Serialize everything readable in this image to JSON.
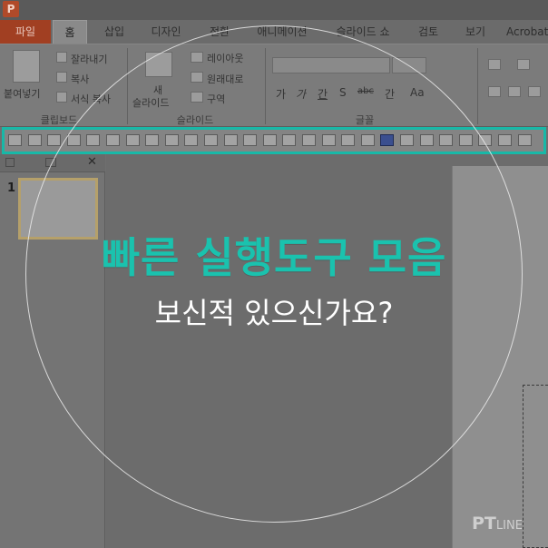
{
  "app": {
    "logo_letter": "P"
  },
  "tabs": [
    {
      "label": "파일"
    },
    {
      "label": "홈"
    },
    {
      "label": "삽입"
    },
    {
      "label": "디자인"
    },
    {
      "label": "전환"
    },
    {
      "label": "애니메이션"
    },
    {
      "label": "슬라이드 쇼"
    },
    {
      "label": "검토"
    },
    {
      "label": "보기"
    },
    {
      "label": "Acrobat"
    }
  ],
  "ribbon": {
    "clipboard": {
      "paste": "붙여넣기",
      "cut": "잘라내기",
      "copy": "복사",
      "format_painter": "서식 복사",
      "group_label": "클립보드"
    },
    "slides": {
      "new_top": "새",
      "new_bottom": "슬라이드",
      "layout": "레이아웃",
      "reset": "원래대로",
      "section": "구역",
      "group_label": "슬라이드"
    },
    "font": {
      "group_label": "글꼴",
      "format_buttons": [
        "가",
        "가",
        "간",
        "S",
        "abc",
        "간",
        "Aa"
      ]
    }
  },
  "quick_access": {
    "icons": [
      "align-left-icon",
      "align-right-icon",
      "align-top-icon",
      "align-bottom-icon",
      "align-center-icon",
      "align-middle-icon",
      "distribute-vertical-icon",
      "distribute-horizontal-icon",
      "group-icon",
      "ungroup-icon",
      "shape-union-icon",
      "shape-combine-icon",
      "shape-fragment-icon",
      "shape-intersect-icon",
      "shape-subtract-icon",
      "flip-vertical-icon",
      "flip-horizontal-icon",
      "rotate-left-icon",
      "rotate-right-icon",
      "save-icon",
      "undo-icon",
      "redo-icon",
      "grid-icon",
      "table-icon",
      "table-insert-icon",
      "table-split-icon",
      "table-merge-icon"
    ]
  },
  "slides": [
    {
      "number": "1"
    }
  ],
  "overlay": {
    "headline": "빠른 실행도구 모음",
    "subline": "보신적 있으신가요?",
    "headline_color": "#1ac2ae",
    "highlight_color": "#18b8a7"
  },
  "watermark": {
    "main": "PT",
    "sub": "LINE"
  }
}
